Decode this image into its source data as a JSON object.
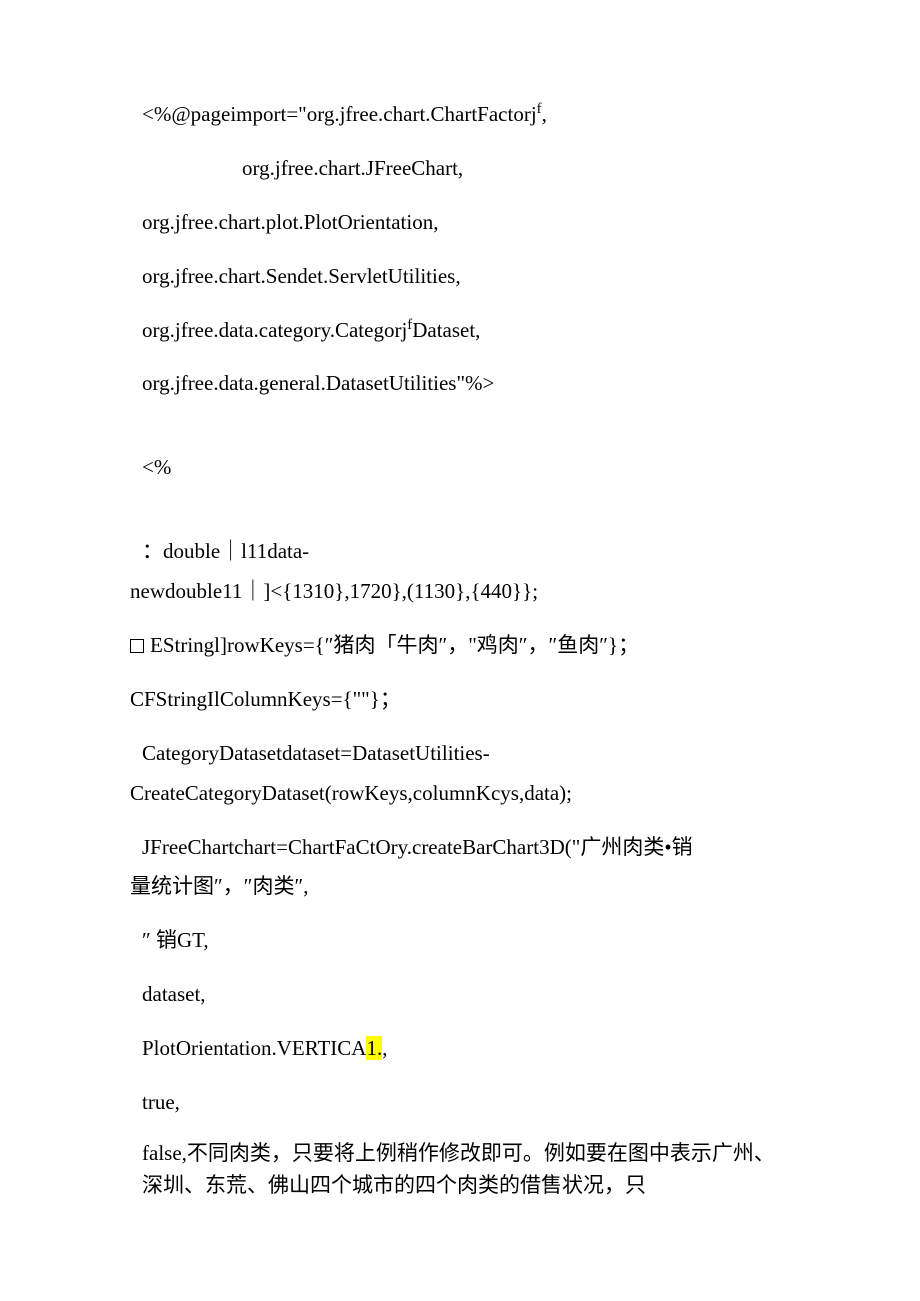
{
  "lines": {
    "l1": "<%@pageimport=\"org.jfree.chart.ChartFactorj",
    "l1sup": "f",
    "l1end": ",",
    "l2": "org.jfree.chart.JFreeChart,",
    "l3": "org.jfree.chart.plot.PlotOrientation,",
    "l4": "org.jfree.chart.Sendet.ServletUtilities,",
    "l5a": "org.jfree.data.category.Categorj",
    "l5sup": "f",
    "l5b": "Dataset,",
    "l6": "org.jfree.data.general.DatasetUtilities\"%>",
    "l7": "<%",
    "l8": " ：double｜l11data-",
    "l9": "newdouble11｜]<{1310},1720},(1130},{440}};",
    "l10": "EStringl]rowKeys={″猪肉「牛肉″，\"鸡肉″，″鱼肉″}；",
    "l11": "CFStringIlColumnKeys={\"\"}；",
    "l12": "CategoryDatasetdataset=DatasetUtilities-",
    "l13": "CreateCategoryDataset(rowKeys,columnKcys,data);",
    "l14": "JFreeChartchart=ChartFaCtOry.createBarChart3D(\"广州肉类•销",
    "l15": "量统计图″，″肉类″,",
    "l16": "″ 销GT,",
    "l17": "dataset,",
    "l18a": "PlotOrientation.VERTICA",
    "l18hl": "1.",
    "l18b": ",",
    "l19": "true,",
    "l20": "false,不同肉类，只要将上例稍作修改即可。例如要在图中表示广州、深圳、东荒、佛山四个城市的四个肉类的借售状况，只"
  }
}
